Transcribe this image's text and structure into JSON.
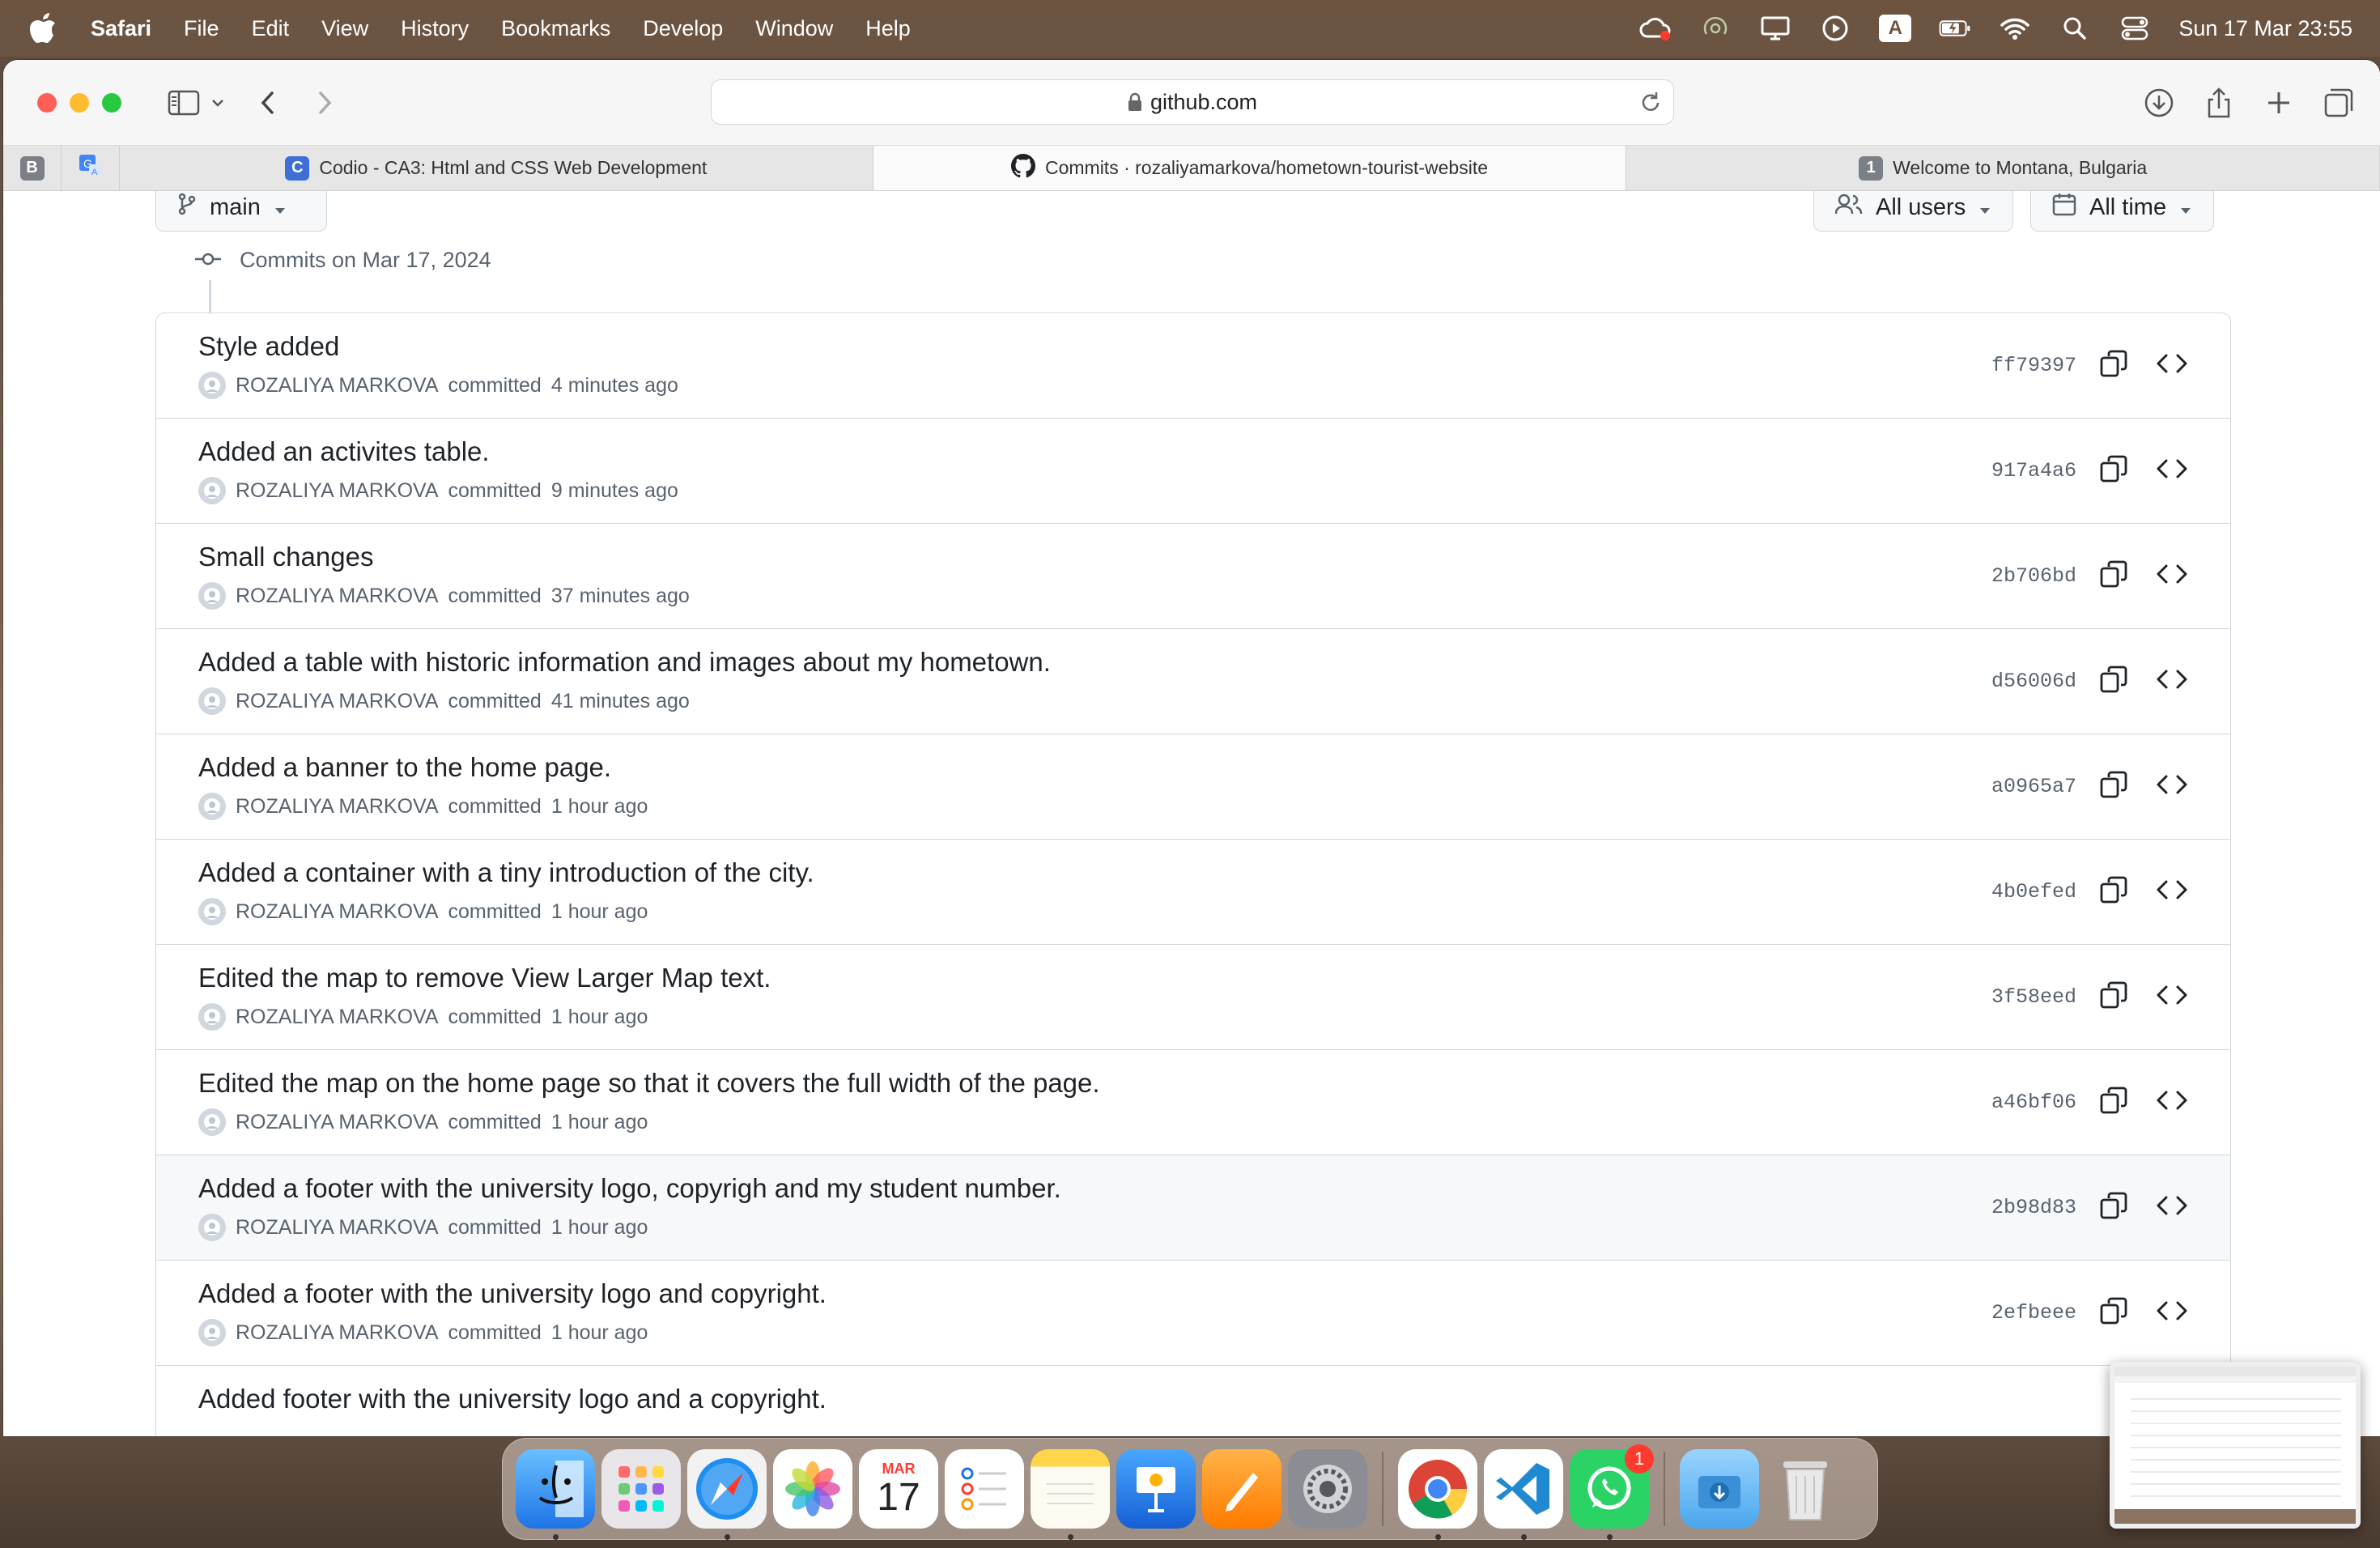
{
  "menubar": {
    "app": "Safari",
    "items": [
      "File",
      "Edit",
      "View",
      "History",
      "Bookmarks",
      "Develop",
      "Window",
      "Help"
    ],
    "input_indicator": "A",
    "clock": "Sun 17 Mar  23:55"
  },
  "safari": {
    "address": "github.com",
    "pinned": [
      "B"
    ],
    "tabs": [
      {
        "label": "Codio - CA3: Html and CSS Web Development",
        "favicon": "C",
        "active": false
      },
      {
        "label": "Commits · rozaliyamarkova/hometown-tourist-website",
        "favicon": "github-icon",
        "active": true
      },
      {
        "label": "Welcome to Montana, Bulgaria",
        "favicon": "1",
        "active": false
      }
    ]
  },
  "filters": {
    "branch": "main",
    "users": "All users",
    "time": "All time"
  },
  "commits_header": "Commits on Mar 17, 2024",
  "commits": [
    {
      "message": "Style added",
      "author": "ROZALIYA MARKOVA",
      "action": "committed",
      "time": "4 minutes ago",
      "sha": "ff79397"
    },
    {
      "message": "Added an activites table.",
      "author": "ROZALIYA MARKOVA",
      "action": "committed",
      "time": "9 minutes ago",
      "sha": "917a4a6"
    },
    {
      "message": "Small changes",
      "author": "ROZALIYA MARKOVA",
      "action": "committed",
      "time": "37 minutes ago",
      "sha": "2b706bd"
    },
    {
      "message": "Added a table with historic information and images about my hometown.",
      "author": "ROZALIYA MARKOVA",
      "action": "committed",
      "time": "41 minutes ago",
      "sha": "d56006d"
    },
    {
      "message": "Added a banner to the home page.",
      "author": "ROZALIYA MARKOVA",
      "action": "committed",
      "time": "1 hour ago",
      "sha": "a0965a7"
    },
    {
      "message": "Added a container with a tiny introduction of the city.",
      "author": "ROZALIYA MARKOVA",
      "action": "committed",
      "time": "1 hour ago",
      "sha": "4b0efed"
    },
    {
      "message": "Edited the map to remove View Larger Map text.",
      "author": "ROZALIYA MARKOVA",
      "action": "committed",
      "time": "1 hour ago",
      "sha": "3f58eed"
    },
    {
      "message": "Edited the map on the home page so that it covers the full width of the page.",
      "author": "ROZALIYA MARKOVA",
      "action": "committed",
      "time": "1 hour ago",
      "sha": "a46bf06"
    },
    {
      "message": "Added a footer with the university logo, copyrigh and my student number.",
      "author": "ROZALIYA MARKOVA",
      "action": "committed",
      "time": "1 hour ago",
      "sha": "2b98d83"
    },
    {
      "message": "Added a footer with the university logo and copyright.",
      "author": "ROZALIYA MARKOVA",
      "action": "committed",
      "time": "1 hour ago",
      "sha": "2efbeee"
    },
    {
      "message": "Added footer with the university logo and a copyright.",
      "author": "",
      "action": "",
      "time": "",
      "sha": ""
    }
  ],
  "dock": {
    "calendar_month": "MAR",
    "calendar_day": "17",
    "whatsapp_badge": "1"
  }
}
